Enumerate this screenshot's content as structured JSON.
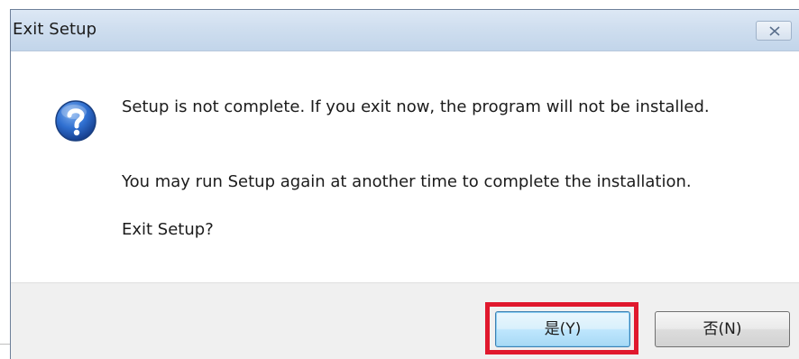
{
  "dialog": {
    "title": "Exit Setup",
    "close_icon": "close-icon",
    "message_icon": "question-icon",
    "message_line1": "Setup is not complete. If you exit now, the program will not be installed.",
    "message_line2": "You may run Setup again at another time to complete the installation.",
    "message_line3": "Exit Setup?",
    "yes_label": "是(Y)",
    "no_label": "否(N)"
  },
  "colors": {
    "highlight": "#e0182d",
    "titlebar": "#cfdeef",
    "footer": "#f0f0f0"
  }
}
